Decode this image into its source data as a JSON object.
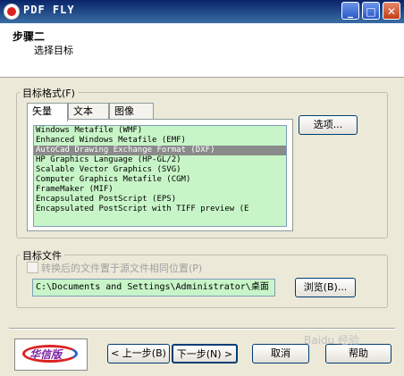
{
  "window": {
    "title": "PDF FLY",
    "minimize": "_",
    "maximize": "□",
    "close": "✕"
  },
  "header": {
    "step_title": "步骤二",
    "step_subtitle": "选择目标"
  },
  "target_format": {
    "group_label": "目标格式(F)",
    "tabs": [
      {
        "label": "矢量"
      },
      {
        "label": "文本"
      },
      {
        "label": "图像"
      }
    ],
    "active_tab": "矢量",
    "options_button": "选项...",
    "formats": [
      "Windows Metafile (WMF)",
      "Enhanced Windows Metafile (EMF)",
      "AutoCad Drawing Exchange Format (DXF)",
      "HP Graphics Language (HP-GL/2)",
      "Scalable Vector Graphics (SVG)",
      "Computer Graphics Metafile (CGM)",
      "FrameMaker (MIF)",
      "Encapsulated PostScript (EPS)",
      "Encapsulated PostScript with TIFF preview (E"
    ],
    "selected_index": 2
  },
  "target_file": {
    "group_label": "目标文件",
    "checkbox_label": "转换后的文件置于源文件相同位置(P)",
    "checkbox_checked": false,
    "path_value": "C:\\Documents and Settings\\Administrator\\桌面",
    "browse_button": "浏览(B)..."
  },
  "footer": {
    "logo_text": "华信版",
    "back_button": "< 上一步(B)",
    "next_button": "下一步(N) >",
    "cancel_button": "取消",
    "help_button": "帮助"
  },
  "watermark": "Baidu 经验"
}
